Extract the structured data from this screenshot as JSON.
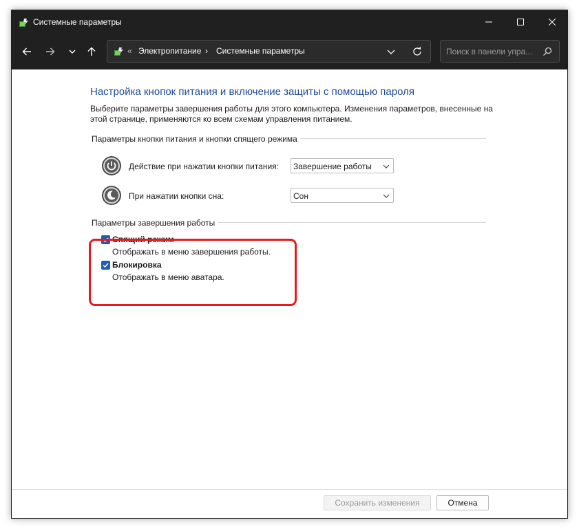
{
  "window": {
    "title": "Системные параметры",
    "controls": {
      "minimize": "minimize-icon",
      "maximize": "maximize-icon",
      "close": "close-icon"
    }
  },
  "navigation": {
    "back": "arrow-left-icon",
    "forward": "arrow-right-icon",
    "recent": "chevron-down-icon",
    "up": "arrow-up-icon",
    "breadcrumb": {
      "overflow": "«",
      "items": [
        "Электропитание",
        "Системные параметры"
      ],
      "separator": "›"
    },
    "search_placeholder": "Поиск в панели упра..."
  },
  "main": {
    "title": "Настройка кнопок питания и включение защиты с помощью пароля",
    "description": "Выберите параметры завершения работы для этого компьютера. Изменения параметров, внесенные на этой странице, применяются ко всем схемам управления питанием.",
    "power_group": {
      "label": "Параметры кнопки питания и кнопки спящего режима",
      "rows": [
        {
          "label": "Действие при нажатии кнопки питания:",
          "value": "Завершение работы",
          "icon": "power-button-icon"
        },
        {
          "label": "При нажатии кнопки сна:",
          "value": "Сон",
          "icon": "sleep-button-icon"
        }
      ]
    },
    "shutdown_group": {
      "label": "Параметры завершения работы",
      "options": [
        {
          "title": "Спящий режим",
          "description": "Отображать в меню завершения работы.",
          "checked": true
        },
        {
          "title": "Блокировка",
          "description": "Отображать в меню аватара.",
          "checked": true
        }
      ]
    }
  },
  "footer": {
    "save_label": "Сохранить изменения",
    "cancel_label": "Отмена"
  },
  "colors": {
    "titlebar": "#202020",
    "title_text": "#1e4a9c",
    "checkbox": "#1f5fb0",
    "highlight": "#e8191f"
  }
}
